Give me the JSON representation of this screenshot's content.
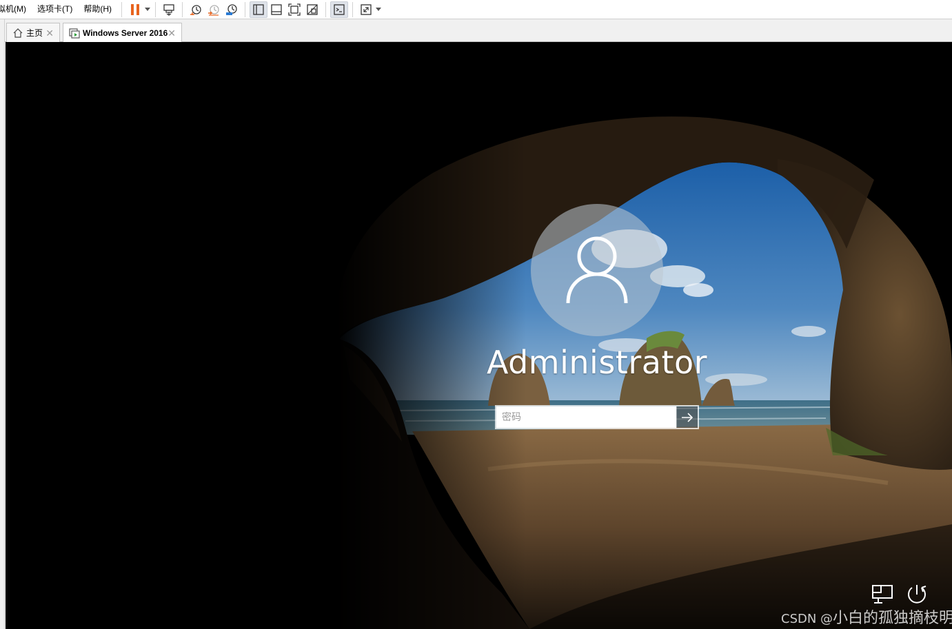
{
  "menu": {
    "items": [
      {
        "label": "拟机(M)"
      },
      {
        "label": "选项卡(T)"
      },
      {
        "label": "帮助(H)"
      }
    ]
  },
  "toolbar": {
    "icons": [
      "pause-icon",
      "send-keys-icon",
      "snapshot-icon",
      "revert-snapshot-icon",
      "snapshot-manager-icon",
      "library-view-icon",
      "thumbnail-view-icon",
      "fullscreen-icon",
      "unity-icon",
      "console-view-icon",
      "stretch-icon"
    ],
    "pause_color": "#e8641e"
  },
  "tabs": [
    {
      "label": "主页",
      "active": false
    },
    {
      "label": "Windows Server 2016",
      "active": true
    }
  ],
  "login": {
    "username": "Administrator",
    "password_placeholder": "密码",
    "submit_icon": "arrow-right-icon"
  },
  "tray": {
    "network_icon": "network-icon",
    "power_icon": "power-icon"
  },
  "watermark": {
    "prefix": "CSDN @",
    "author": "小白的孤独摘枝明"
  }
}
